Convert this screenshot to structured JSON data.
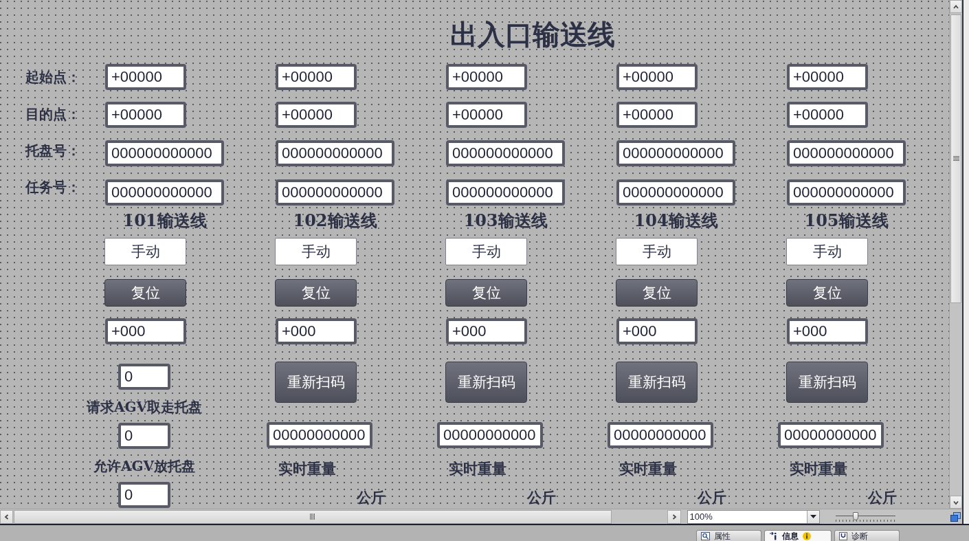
{
  "title": "出入口输送线",
  "row_labels": [
    "起始点：",
    "目的点：",
    "托盘号：",
    "任务号："
  ],
  "lines": [
    {
      "kind": "agv",
      "start_point": "+00000",
      "destination": "+00000",
      "pallet_no": "000000000000",
      "task_no": "000000000000",
      "name": "101输送线",
      "manual_button": "手动",
      "reset_button": "复位",
      "counter": "+000",
      "agv_signals": [
        {
          "value": "0",
          "label": "请求AGV取走托盘"
        },
        {
          "value": "0",
          "label": "允许AGV放托盘"
        },
        {
          "value": "0"
        }
      ]
    },
    {
      "kind": "scan",
      "start_point": "+00000",
      "destination": "+00000",
      "pallet_no": "000000000000",
      "task_no": "000000000000",
      "name": "102输送线",
      "manual_button": "手动",
      "reset_button": "复位",
      "counter": "+000",
      "rescan_button": "重新扫码",
      "weight": "00000000000",
      "weight_label": "实时重量",
      "unit": "公斤"
    },
    {
      "kind": "scan",
      "start_point": "+00000",
      "destination": "+00000",
      "pallet_no": "000000000000",
      "task_no": "000000000000",
      "name": "103输送线",
      "manual_button": "手动",
      "reset_button": "复位",
      "counter": "+000",
      "rescan_button": "重新扫码",
      "weight": "00000000000",
      "weight_label": "实时重量",
      "unit": "公斤"
    },
    {
      "kind": "scan",
      "start_point": "+00000",
      "destination": "+00000",
      "pallet_no": "000000000000",
      "task_no": "000000000000",
      "name": "104输送线",
      "manual_button": "手动",
      "reset_button": "复位",
      "counter": "+000",
      "rescan_button": "重新扫码",
      "weight": "00000000000",
      "weight_label": "实时重量",
      "unit": "公斤"
    },
    {
      "kind": "scan",
      "start_point": "+00000",
      "destination": "+00000",
      "pallet_no": "000000000000",
      "task_no": "000000000000",
      "name": "105输送线",
      "manual_button": "手动",
      "reset_button": "复位",
      "counter": "+000",
      "rescan_button": "重新扫码",
      "weight": "00000000000",
      "weight_label": "实时重量",
      "unit": "公斤"
    }
  ],
  "zoom": {
    "value": "100%"
  },
  "zoom_slider": {
    "level": 0.34
  },
  "panel_tabs": [
    {
      "kind": "properties",
      "label": "属性",
      "selected": false
    },
    {
      "kind": "info",
      "label": "信息",
      "selected": true
    },
    {
      "kind": "diagnostics",
      "label": "诊断",
      "selected": false
    }
  ]
}
